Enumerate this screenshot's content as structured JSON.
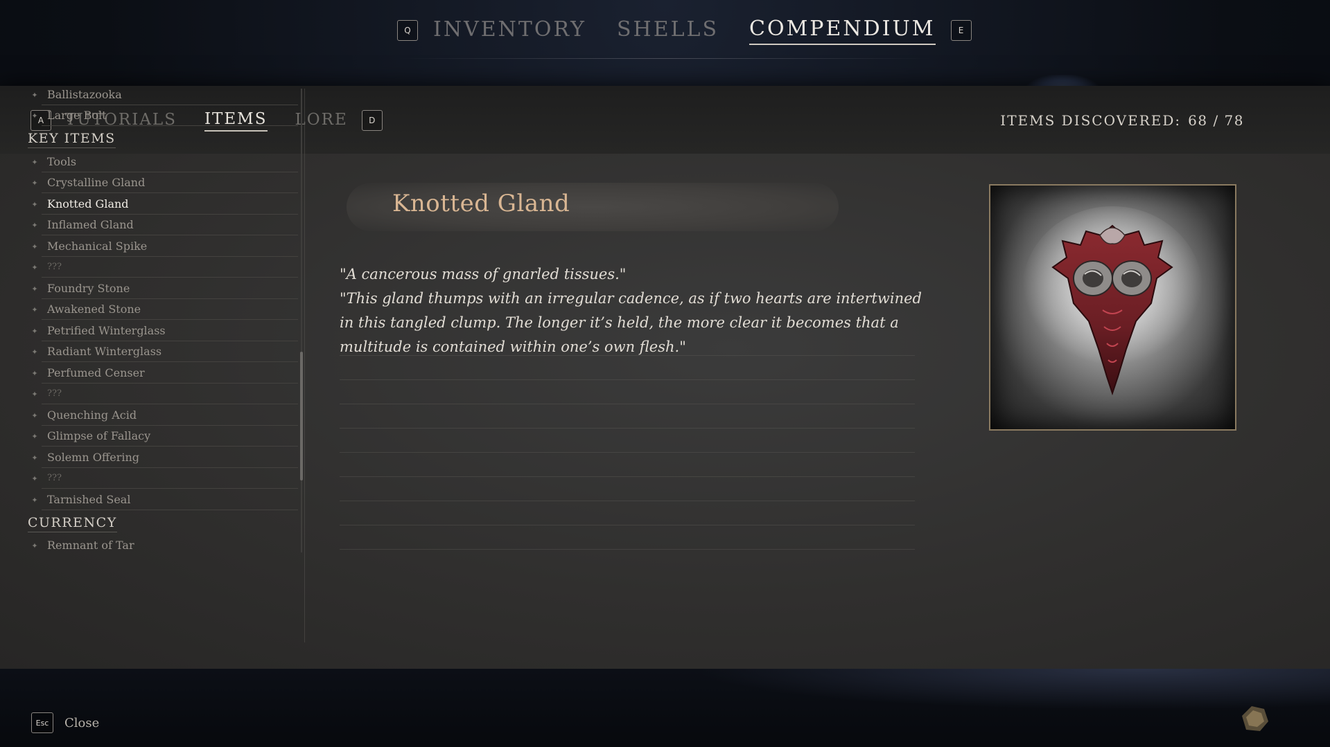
{
  "top_nav": {
    "left_key": "Q",
    "right_key": "E",
    "tabs": [
      "INVENTORY",
      "SHELLS",
      "COMPENDIUM"
    ],
    "active": "COMPENDIUM"
  },
  "sub_nav": {
    "left_key": "A",
    "right_key": "D",
    "tabs": [
      "TUTORIALS",
      "ITEMS",
      "LORE"
    ],
    "active": "ITEMS"
  },
  "discovered": {
    "label": "ITEMS DISCOVERED:",
    "count": "68 / 78"
  },
  "list": {
    "pre_items": [
      "Ballistazooka",
      "Large Bolt"
    ],
    "key_items_header": "KEY ITEMS",
    "key_items": [
      "Tools",
      "Crystalline Gland",
      "Knotted Gland",
      "Inflamed Gland",
      "Mechanical Spike",
      "???",
      "Foundry Stone",
      "Awakened Stone",
      "Petrified Winterglass",
      "Radiant Winterglass",
      "Perfumed Censer",
      "???",
      "Quenching Acid",
      "Glimpse of Fallacy",
      "Solemn Offering",
      "???",
      "Tarnished Seal"
    ],
    "selected": "Knotted Gland",
    "currency_header": "CURRENCY",
    "currency_items": [
      "Remnant of Tar"
    ]
  },
  "detail": {
    "title": "Knotted Gland",
    "quote_1": "\"A cancerous mass of gnarled tissues.\"",
    "quote_2": "\"This gland thumps with an irregular cadence, as if two hearts are intertwined in this tangled clump. The longer it’s held, the more clear it becomes that a multitude is contained within one’s own flesh.\""
  },
  "bottom": {
    "close_key": "Esc",
    "close_label": "Close"
  },
  "colors": {
    "title": "#d9b693",
    "selected_text": "#f0ece5",
    "frame_border": "#8a7a60"
  }
}
